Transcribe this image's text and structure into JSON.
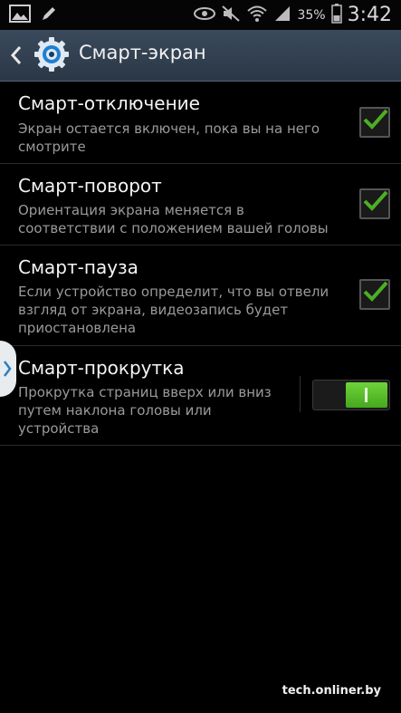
{
  "status_bar": {
    "battery_percent": "35%",
    "time": "3:42",
    "icons_left": [
      "gallery-icon",
      "pen-icon"
    ],
    "icons_right": [
      "eye-icon",
      "mute-icon",
      "wifi-icon",
      "signal-icon",
      "battery-icon"
    ]
  },
  "action_bar": {
    "title": "Смарт-экран",
    "back_icon": "chevron-left-icon",
    "app_icon": "gear-icon"
  },
  "settings": [
    {
      "title": "Смарт-отключение",
      "desc_lines": [
        "Экран остается включен, пока вы на него",
        "смотрите"
      ],
      "control": "checkbox",
      "checked": true
    },
    {
      "title": "Смарт-поворот",
      "desc_lines": [
        "Ориентация экрана меняется в",
        "соответствии с положением вашей головы"
      ],
      "control": "checkbox",
      "checked": true
    },
    {
      "title": "Смарт-пауза",
      "desc_lines": [
        "Если устройство определит, что вы отвели",
        "взгляд от экрана, видеозапись будет",
        "приостановлена"
      ],
      "control": "checkbox",
      "checked": true
    },
    {
      "title": "Смарт-прокрутка",
      "desc_lines": [
        "Прокрутка страниц вверх или вниз",
        "путем наклона головы или",
        "устройства"
      ],
      "control": "toggle",
      "toggle_on": true
    }
  ],
  "colors": {
    "accent_green": "#4caf24",
    "action_bar": "#34414f"
  },
  "watermark": "tech.onliner.by"
}
